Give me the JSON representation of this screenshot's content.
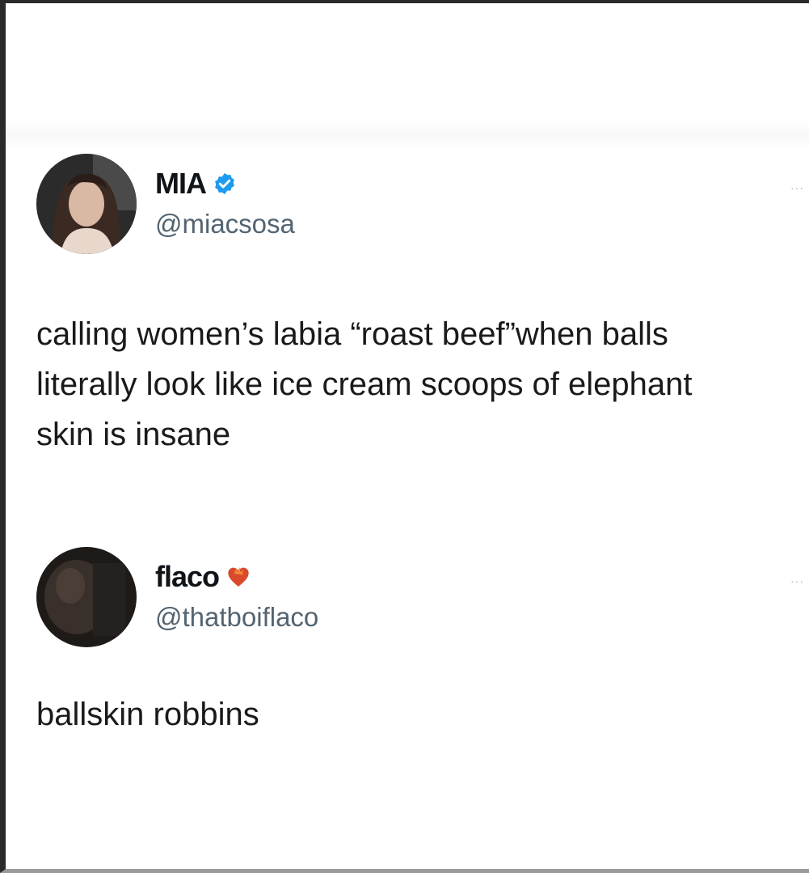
{
  "tweets": [
    {
      "display_name": "MIA",
      "handle": "@miacsosa",
      "badge_icon": "verified-badge-icon",
      "more_icon": "more-options-icon",
      "more_label": "···",
      "text": "calling women’s labia “roast beef”when balls\nliterally look like ice cream scoops of elephant\nskin is insane"
    },
    {
      "display_name": "flaco",
      "handle": "@thatboiflaco",
      "badge_icon": "flame-heart-icon",
      "more_icon": "more-options-icon",
      "more_label": "···",
      "text": "ballskin robbins"
    }
  ],
  "colors": {
    "verified_blue": "#1d9bf0",
    "handle_gray": "#536471",
    "emoji_red": "#d94a2b"
  }
}
